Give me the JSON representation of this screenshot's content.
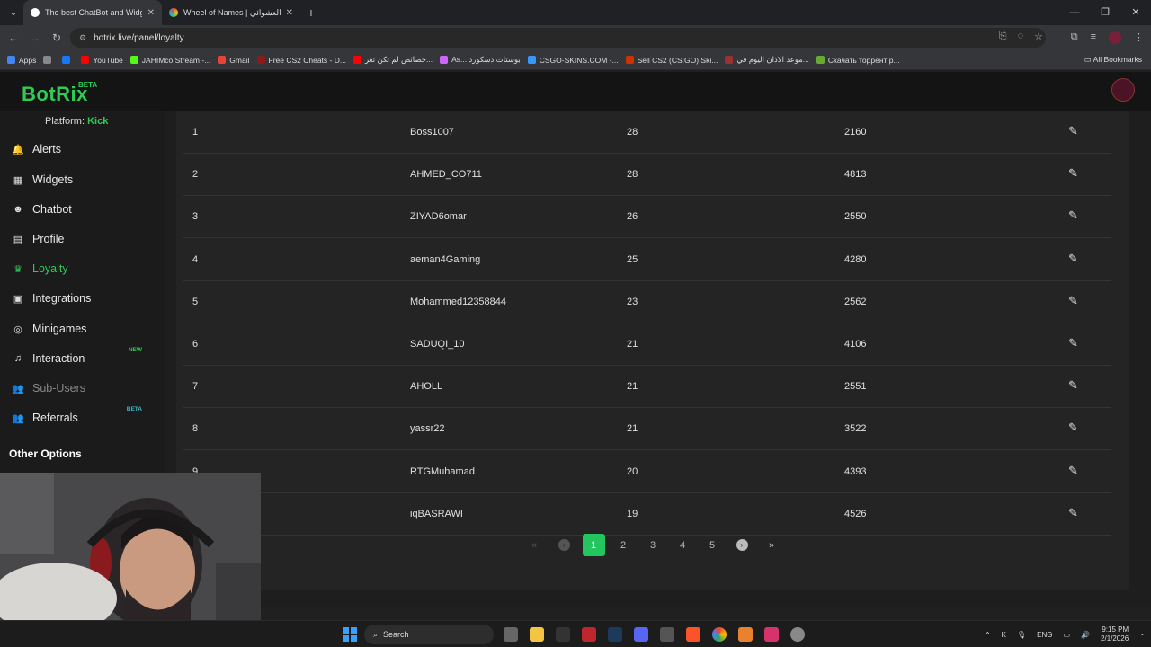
{
  "browser": {
    "tabs": [
      {
        "title": "The best ChatBot and Widgets",
        "active": true,
        "favicon_color": "#ffffff"
      },
      {
        "title": "Wheel of Names | عسم العشوائي",
        "active": false,
        "favicon_color": "#e84c3d"
      }
    ],
    "new_tab": "+",
    "url": "botrix.live/panel/loyalty",
    "bookmarks": [
      {
        "label": "Apps",
        "color": "#4285f4"
      },
      {
        "label": "",
        "color": "#888888"
      },
      {
        "label": "",
        "color": "#1877f2"
      },
      {
        "label": "YouTube",
        "color": "#ff0000"
      },
      {
        "label": "JAHIMco Stream -...",
        "color": "#53fc18"
      },
      {
        "label": "Gmail",
        "color": "#ea4335"
      },
      {
        "label": "Free CS2 Cheats - D...",
        "color": "#8b1a1a"
      },
      {
        "label": "خصائص لم تكن تعر...",
        "color": "#ff0000"
      },
      {
        "label": "As... بوستات دسكورد",
        "color": "#cc66ff"
      },
      {
        "label": "CSGO-SKINS.COM -...",
        "color": "#3399ff"
      },
      {
        "label": "Sell CS2 (CS:GO) Ski...",
        "color": "#cc3300"
      },
      {
        "label": "موعد الاذان اليوم في...",
        "color": "#993333"
      },
      {
        "label": "Скачать торрент р...",
        "color": "#66aa33"
      }
    ],
    "all_bookmarks": "All Bookmarks"
  },
  "app": {
    "logo": "BotRix",
    "logo_badge": "BETA",
    "platform_label": "Platform:",
    "platform_value": "Kick"
  },
  "sidebar": {
    "items": [
      {
        "label": "Alerts",
        "icon": "bell-icon",
        "glyph": "🔔"
      },
      {
        "label": "Widgets",
        "icon": "grid-icon",
        "glyph": "▦"
      },
      {
        "label": "Chatbot",
        "icon": "robot-icon",
        "glyph": "☻"
      },
      {
        "label": "Profile",
        "icon": "id-card-icon",
        "glyph": "▤"
      },
      {
        "label": "Loyalty",
        "icon": "trophy-icon",
        "glyph": "♛"
      },
      {
        "label": "Integrations",
        "icon": "chat-icon",
        "glyph": "▣"
      },
      {
        "label": "Minigames",
        "icon": "gamepad-icon",
        "glyph": "◎"
      },
      {
        "label": "Interaction",
        "icon": "music-icon",
        "glyph": "♫",
        "badge": "NEW"
      },
      {
        "label": "Sub-Users",
        "icon": "users-icon",
        "glyph": "👥"
      },
      {
        "label": "Referrals",
        "icon": "user-group-icon",
        "glyph": "👥",
        "badge": "BETA"
      }
    ],
    "other_options": "Other Options"
  },
  "colors": {
    "accent": "#2ecc55",
    "badge_new": "#2ecc55",
    "badge_beta": "#3fb6c9"
  },
  "table": {
    "rows": [
      {
        "rank": "1",
        "name": "Boss1007",
        "val1": "28",
        "val2": "2160"
      },
      {
        "rank": "2",
        "name": "AHMED_CO711",
        "val1": "28",
        "val2": "4813"
      },
      {
        "rank": "3",
        "name": "ZIYAD6omar",
        "val1": "26",
        "val2": "2550"
      },
      {
        "rank": "4",
        "name": "aeman4Gaming",
        "val1": "25",
        "val2": "4280"
      },
      {
        "rank": "5",
        "name": "Mohammed12358844",
        "val1": "23",
        "val2": "2562"
      },
      {
        "rank": "6",
        "name": "SADUQI_10",
        "val1": "21",
        "val2": "4106"
      },
      {
        "rank": "7",
        "name": "AHOLL",
        "val1": "21",
        "val2": "2551"
      },
      {
        "rank": "8",
        "name": "yassr22",
        "val1": "21",
        "val2": "3522"
      },
      {
        "rank": "9",
        "name": "RTGMuhamad",
        "val1": "20",
        "val2": "4393"
      },
      {
        "rank": "",
        "name": "iqBASRAWI",
        "val1": "19",
        "val2": "4526"
      }
    ],
    "edit_icon": "pencil-icon"
  },
  "pagination": {
    "first": "«",
    "prev": "‹",
    "pages": [
      "1",
      "2",
      "3",
      "4",
      "5"
    ],
    "current": "1",
    "next": "›",
    "last": "»"
  },
  "taskbar": {
    "search": "Search",
    "lang": "ENG",
    "time": "9:15 PM",
    "date": "2/1/2026"
  }
}
